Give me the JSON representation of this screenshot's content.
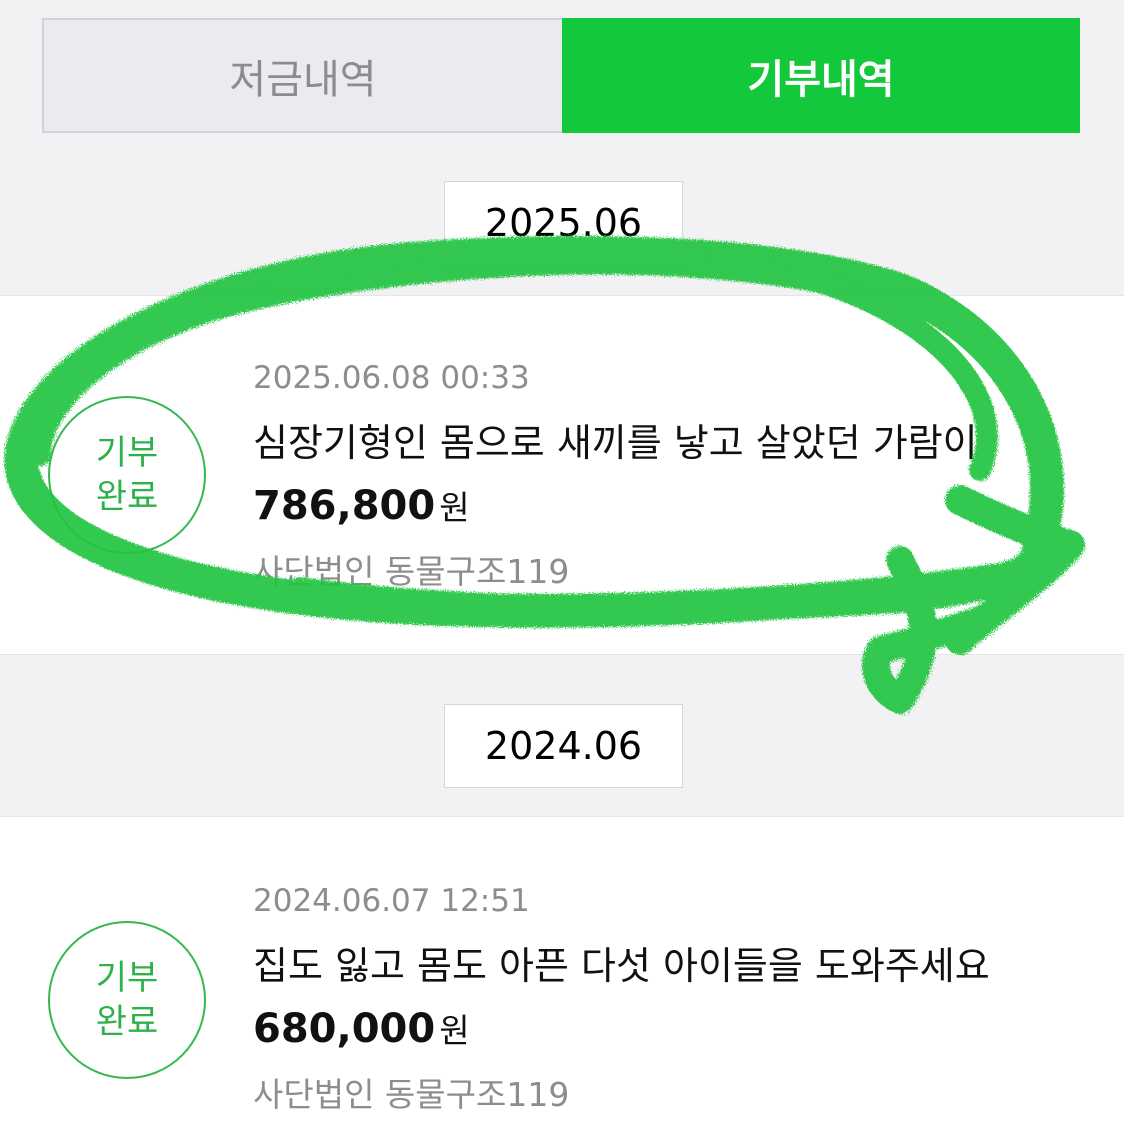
{
  "tabs": [
    {
      "label": "저금내역",
      "active": false
    },
    {
      "label": "기부내역",
      "active": true
    }
  ],
  "groups": [
    {
      "month": "2025.06",
      "item": {
        "badge": [
          "기부",
          "완료"
        ],
        "timestamp": "2025.06.08 00:33",
        "title": "심장기형인 몸으로 새끼를 낳고 살았던 가람이",
        "amount": "786,800",
        "currency": "원",
        "organization": "사단법인 동물구조119"
      }
    },
    {
      "month": "2024.06",
      "item": {
        "badge": [
          "기부",
          "완료"
        ],
        "timestamp": "2024.06.07 12:51",
        "title": "집도 잃고 몸도 아픈 다섯 아이들을 도와주세요",
        "amount": "680,000",
        "currency": "원",
        "organization": "사단법인 동물구조119"
      }
    }
  ],
  "colors": {
    "accent": "#14c83c",
    "badge": "#2fb14a",
    "annotation": "#22c443"
  }
}
